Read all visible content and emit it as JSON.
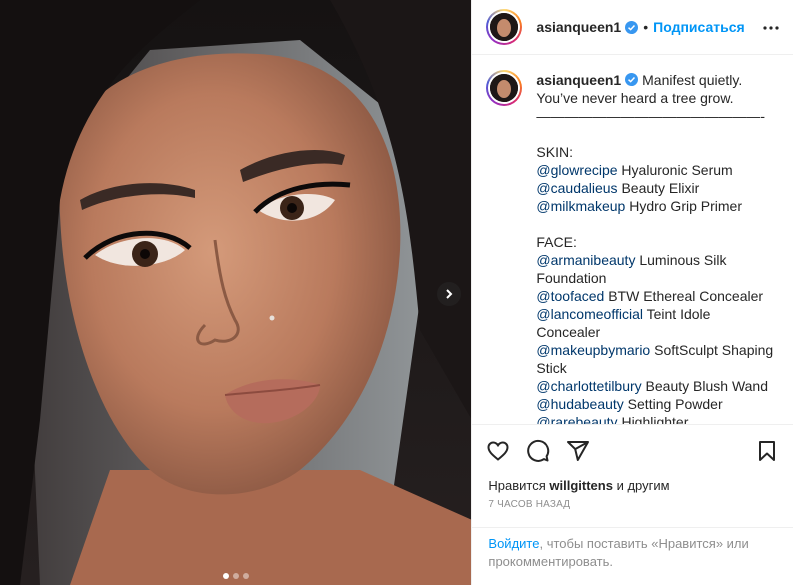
{
  "post": {
    "username": "asianqueen1",
    "separator": "•",
    "follow_label": "Подписаться",
    "caption_lines": [
      {
        "parts": [
          {
            "t": "Manifest quietly."
          }
        ]
      },
      {
        "parts": [
          {
            "t": "You’ve never heard a tree grow."
          }
        ]
      },
      {
        "parts": [
          {
            "t": "————————————————-"
          }
        ]
      },
      {
        "parts": [
          {
            "t": " "
          }
        ]
      },
      {
        "parts": [
          {
            "t": "SKIN:"
          }
        ]
      },
      {
        "parts": [
          {
            "t": "@glowrecipe",
            "m": true
          },
          {
            "t": " Hyaluronic Serum"
          }
        ]
      },
      {
        "parts": [
          {
            "t": "@caudalieus",
            "m": true
          },
          {
            "t": " Beauty Elixir"
          }
        ]
      },
      {
        "parts": [
          {
            "t": "@milkmakeup",
            "m": true
          },
          {
            "t": " Hydro Grip Primer"
          }
        ]
      },
      {
        "parts": [
          {
            "t": " "
          }
        ]
      },
      {
        "parts": [
          {
            "t": "FACE:"
          }
        ]
      },
      {
        "parts": [
          {
            "t": "@armanibeauty",
            "m": true
          },
          {
            "t": " Luminous Silk"
          }
        ]
      },
      {
        "parts": [
          {
            "t": "Foundation"
          }
        ]
      },
      {
        "parts": [
          {
            "t": "@toofaced",
            "m": true
          },
          {
            "t": " BTW Ethereal Concealer"
          }
        ]
      },
      {
        "parts": [
          {
            "t": "@lancomeofficial",
            "m": true
          },
          {
            "t": " Teint Idole"
          }
        ]
      },
      {
        "parts": [
          {
            "t": "Concealer"
          }
        ]
      },
      {
        "parts": [
          {
            "t": "@makeupbymario",
            "m": true
          },
          {
            "t": " SoftSculpt Shaping"
          }
        ]
      },
      {
        "parts": [
          {
            "t": "Stick"
          }
        ]
      },
      {
        "parts": [
          {
            "t": "@charlottetilbury",
            "m": true
          },
          {
            "t": " Beauty Blush Wand"
          }
        ]
      },
      {
        "parts": [
          {
            "t": "@hudabeauty",
            "m": true
          },
          {
            "t": " Setting Powder"
          }
        ]
      },
      {
        "parts": [
          {
            "t": "@rarebeauty",
            "m": true
          },
          {
            "t": " Highlighter"
          }
        ]
      }
    ],
    "likes_prefix": "Нравится ",
    "likes_user": "willgittens",
    "likes_suffix": " и другим",
    "time_ago": "7 ЧАСОВ НАЗАД",
    "login_link": "Войдите",
    "login_text": ", чтобы поставить «Нравится» или прокомментировать.",
    "carousel": {
      "total": 3,
      "active": 0
    }
  },
  "icons": {
    "more": "more-horizontal-icon",
    "verified": "verified-badge-icon",
    "like": "heart-outline-icon",
    "comment": "comment-bubble-icon",
    "share": "paper-plane-icon",
    "save": "bookmark-outline-icon",
    "next": "chevron-right-icon"
  },
  "colors": {
    "link": "#0095f6",
    "mention": "#00376b",
    "muted": "#8e8e8e",
    "text": "#262626"
  }
}
